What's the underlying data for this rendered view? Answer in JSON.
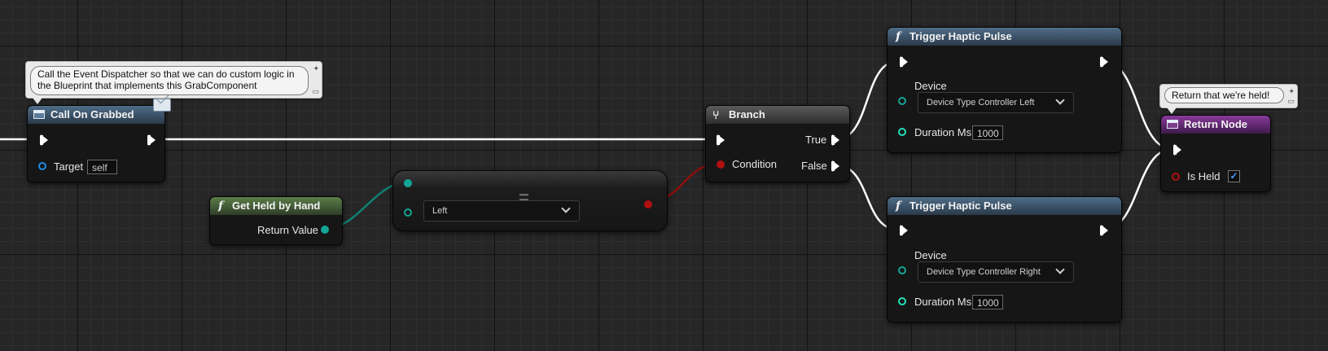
{
  "nodes": {
    "call_on_grabbed": {
      "title": "Call On Grabbed",
      "icon": "event-dispatcher-icon",
      "target_label": "Target",
      "target_value": "self",
      "comment": "Call the Event Dispatcher so that we can do custom logic in the Blueprint that implements this GrabComponent"
    },
    "get_held_by_hand": {
      "title": "Get Held by Hand",
      "icon": "function-icon",
      "output_label": "Return Value"
    },
    "equal_enum": {
      "dropdown_value": "Left"
    },
    "branch": {
      "title": "Branch",
      "condition_label": "Condition",
      "true_label": "True",
      "false_label": "False"
    },
    "haptic_top": {
      "title": "Trigger Haptic Pulse",
      "device_label": "Device",
      "device_value": "Device Type Controller Left",
      "duration_label": "Duration Ms",
      "duration_value": "1000"
    },
    "haptic_bottom": {
      "title": "Trigger Haptic Pulse",
      "device_label": "Device",
      "device_value": "Device Type Controller Right",
      "duration_label": "Duration Ms",
      "duration_value": "1000"
    },
    "return_node": {
      "title": "Return Node",
      "is_held_label": "Is Held",
      "is_held_checked": true,
      "comment": "Return that we're held!"
    }
  },
  "colors": {
    "exec_wire": "#ffffff",
    "enum_wire": "#0f7f74",
    "bool_wire": "#8e0d0d",
    "object_pin": "#1e8be6",
    "enum_pin": "#12a595",
    "bool_pin": "#b01010",
    "int_pin": "#1fe0b8"
  }
}
